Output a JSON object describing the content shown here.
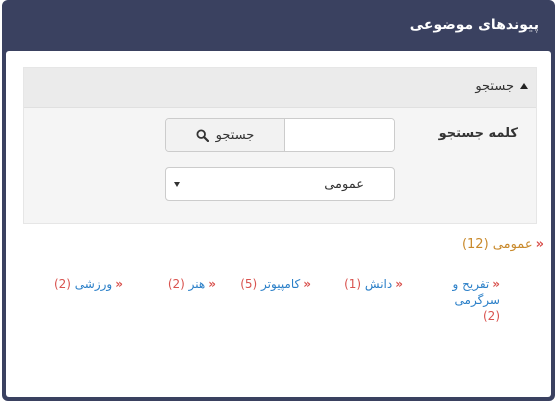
{
  "panel": {
    "title": "پیوندهای موضوعی"
  },
  "search": {
    "header": "جستجو",
    "keyword_label": "کلمه جستجو",
    "button_label": "جستجو",
    "input_value": "",
    "select_value": "عمومی"
  },
  "category": {
    "name": "عمومی",
    "count": "(12)"
  },
  "links": [
    {
      "name": "تفریح و سرگرمی",
      "count": "(2)"
    },
    {
      "name": "دانش",
      "count": "(1)"
    },
    {
      "name": "کامپیوتر",
      "count": "(5)"
    },
    {
      "name": "هنر",
      "count": "(2)"
    },
    {
      "name": "ورزشی",
      "count": "(2)"
    }
  ],
  "colors": {
    "header_bg": "#3a4160",
    "link": "#2a7fc8",
    "count": "#d9534f",
    "category": "#c98a2c"
  }
}
